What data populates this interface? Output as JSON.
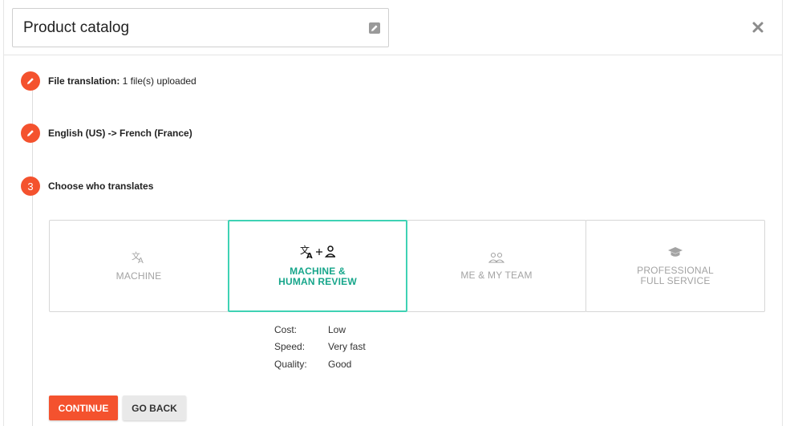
{
  "header": {
    "title": "Product catalog"
  },
  "steps": [
    {
      "marker": "pencil",
      "label_bold": "File translation:",
      "label_rest": " 1 file(s) uploaded"
    },
    {
      "marker": "pencil",
      "label_bold": "English (US) -> French (France)",
      "label_rest": ""
    },
    {
      "marker": "3",
      "label_bold": "Choose who translates",
      "label_rest": ""
    }
  ],
  "options": [
    {
      "label": "MACHINE",
      "icon": "translate-icon",
      "selected": false
    },
    {
      "label": "MACHINE &\nHUMAN REVIEW",
      "icon": "translate-plus-person-icon",
      "selected": true
    },
    {
      "label": "ME & MY TEAM",
      "icon": "people-icon",
      "selected": false
    },
    {
      "label": "PROFESSIONAL\nFULL SERVICE",
      "icon": "graduation-cap-icon",
      "selected": false
    }
  ],
  "details": [
    {
      "key": "Cost:",
      "value": "Low"
    },
    {
      "key": "Speed:",
      "value": "Very fast"
    },
    {
      "key": "Quality:",
      "value": "Good"
    }
  ],
  "buttons": {
    "continue": "CONTINUE",
    "back": "GO BACK"
  },
  "colors": {
    "accent": "#f4522e",
    "selected": "#3fd2b4",
    "selected_text": "#17a68b"
  }
}
